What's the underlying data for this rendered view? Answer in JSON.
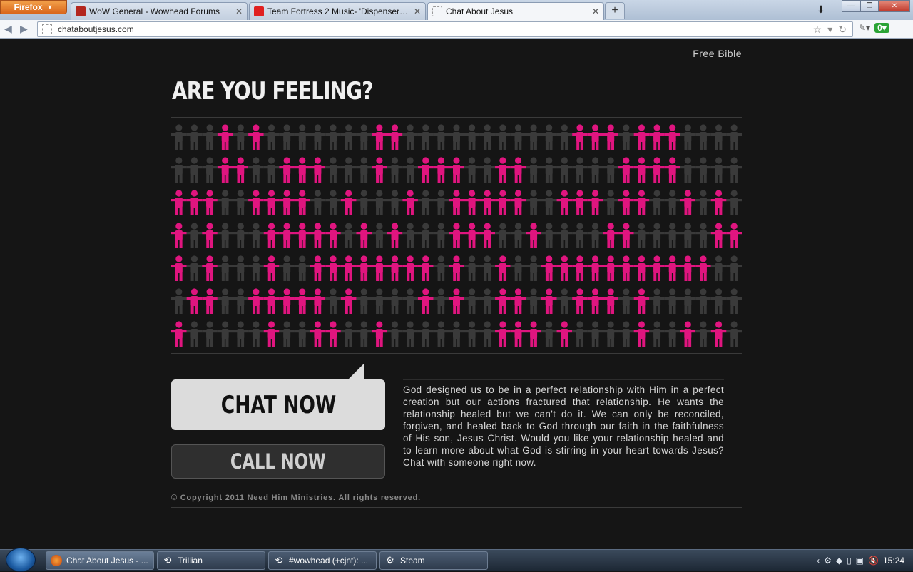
{
  "browser": {
    "menu_button": "Firefox",
    "tabs": [
      {
        "label": "WoW General - Wowhead Forums",
        "favicon_color": "#b3261e"
      },
      {
        "label": "Team Fortress 2 Music- 'Dispenser Er...",
        "favicon_color": "#e02020"
      },
      {
        "label": "Chat About Jesus",
        "favicon_color": "#ffffff"
      }
    ],
    "new_tab": "+",
    "url": "chataboutjesus.com"
  },
  "page": {
    "top_link": "Free Bible",
    "headline": "ARE YOU FEELING?",
    "people_colors": {
      "highlight": "#e0157f",
      "muted": "#3a3a3a"
    },
    "people_rows": [
      "0001010000000110000000000011101110000",
      "0001100111000100111001100000011110000",
      "1110011110010001001111100111011001010",
      "1010001111101010001110010000110000011",
      "1010001001111111101001001111111111100",
      "0110011111010000101001101011101000000",
      "1000001001100100000001110100001001010"
    ],
    "chat_button": "CHAT NOW",
    "call_button": "CALL NOW",
    "body_text": "God designed us to be in a perfect relationship with Him in a perfect creation but our actions fractured that relationship. He wants the relationship healed but we can't do it. We can only be reconciled, forgiven, and healed back to God through our faith in the faithfulness of His son, Jesus Christ. Would you like your relationship healed and to learn more about what God is stirring in your heart towards Jesus? Chat with someone right now.",
    "copyright": "© Copyright 2011 Need Him Ministries. All rights reserved."
  },
  "taskbar": {
    "tasks": [
      {
        "label": "Chat About Jesus - ...",
        "icon": "firefox-icon"
      },
      {
        "label": "Trillian",
        "icon": "trillian-icon"
      },
      {
        "label": "#wowhead (+cjnt): ...",
        "icon": "trillian-icon"
      },
      {
        "label": "Steam",
        "icon": "steam-icon"
      }
    ],
    "clock": "15:24"
  }
}
